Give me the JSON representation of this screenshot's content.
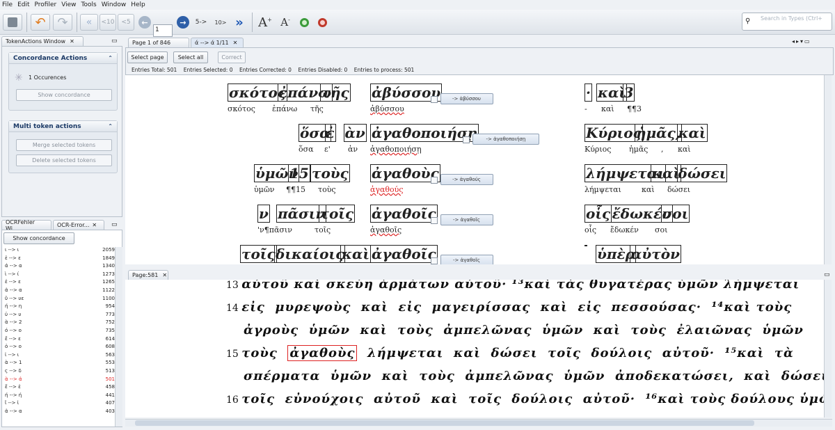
{
  "menu": [
    "File",
    "Edit",
    "Profiler",
    "View",
    "Tools",
    "Window",
    "Help"
  ],
  "toolbar": {
    "back_10": "<10",
    "back_5": "<5",
    "page_input": "1",
    "fwd_5": "5->",
    "fwd_10": "10>",
    "search_placeholder": "Search in Types (Ctrl+"
  },
  "token_actions": {
    "tab_label": "TokenActions Window",
    "concordance_title": "Concordance Actions",
    "occurrences": "1 Occurences",
    "show_concordance": "Show concordance",
    "multi_title": "Multi token actions",
    "merge": "Merge selected tokens",
    "delete": "Delete selected tokens"
  },
  "error_panel": {
    "tab1": "OCRFehler Wi...",
    "tab2": "OCR-Error...",
    "show_concordance": "Show concordance",
    "rows": [
      {
        "pattern": "ι --> ι",
        "count": "2059",
        "red": false
      },
      {
        "pattern": "ἑ --> ε",
        "count": "1849",
        "red": false
      },
      {
        "pattern": "ά --> α",
        "count": "1340",
        "red": false
      },
      {
        "pattern": "ὶ --> ί",
        "count": "1273",
        "red": false
      },
      {
        "pattern": "ἐ --> ε",
        "count": "1265",
        "red": false
      },
      {
        "pattern": "ἀ --> α",
        "count": "1122",
        "red": false
      },
      {
        "pattern": "ῦ --> υε",
        "count": "1100",
        "red": false
      },
      {
        "pattern": "ή --> η",
        "count": "954",
        "red": false
      },
      {
        "pattern": "ὐ --> υ",
        "count": "773",
        "red": false
      },
      {
        "pattern": "ὰ --> 2",
        "count": "752",
        "red": false
      },
      {
        "pattern": "ό --> ο",
        "count": "735",
        "red": false
      },
      {
        "pattern": "ἔ --> ε",
        "count": "614",
        "red": false
      },
      {
        "pattern": "ὁ --> ο",
        "count": "608",
        "red": false
      },
      {
        "pattern": "ἰ --> ι",
        "count": "563",
        "red": false
      },
      {
        "pattern": "ὰ --> 1",
        "count": "553",
        "red": false
      },
      {
        "pattern": "ς --> δ",
        "count": "513",
        "red": false
      },
      {
        "pattern": "ὰ --> ά",
        "count": "501",
        "red": true
      },
      {
        "pattern": "ἕ --> ἑ",
        "count": "458",
        "red": false
      },
      {
        "pattern": "ή --> ή",
        "count": "441",
        "red": false
      },
      {
        "pattern": "ῖ --> ἰ",
        "count": "407",
        "red": false
      },
      {
        "pattern": "ἀ --> α",
        "count": "403",
        "red": false
      }
    ]
  },
  "concordance": {
    "tab_page": "Page 1 of 846",
    "tab_conc": "ά --> ά 1/11",
    "select_page": "Select page",
    "select_all": "Select all",
    "correct": "Correct",
    "stats": "Entries Total: 501    Entries Selected: 0    Entries Corrected: 0    Entries Disabled: 0    Entries to process: 501",
    "rows": [
      {
        "left_img": [
          "σκότος",
          "ἐπάνω",
          "τῆς"
        ],
        "left_ocr": [
          "σκότος",
          "ἐπάνω",
          "τῆς"
        ],
        "mid_img": "ἀβύσσου",
        "mid_ocr": "ἀβύσσου",
        "btn": "-> ἀβύσσου",
        "right_img": [
          "·",
          "καὶ",
          "3"
        ],
        "right_ocr": [
          "-",
          "καὶ",
          "¶¶3"
        ]
      },
      {
        "left_img": [
          "ὅσα",
          "ἐ",
          "ὰν"
        ],
        "left_ocr": [
          "ὅσα",
          "ε'",
          "ἀν"
        ],
        "mid_img": "ἀγαθοποιήσῃ",
        "mid_ocr": "ἀγαθοποιήσῃ",
        "btn": "-> ἀγαθοποιήσῃ",
        "right_img": [
          "Κύριος",
          "ἡμᾶς,",
          "καὶ"
        ],
        "right_ocr": [
          "Κύριος",
          "ἡμᾶς",
          ",",
          "καὶ"
        ]
      },
      {
        "left_img": [
          "ὑμῶν",
          "15",
          "τοὺς"
        ],
        "left_ocr": [
          "ὑμῶν",
          "¶¶15",
          "τοὺς"
        ],
        "mid_img": "ἀγαθοὺς",
        "mid_ocr": "ἀγαθούς",
        "btn": "-> ἀγαθούς",
        "right_img": [
          "λήμψεται",
          "καὶ",
          "δώσει"
        ],
        "right_ocr": [
          "λήμψεται",
          "καὶ",
          "δώσει"
        ]
      },
      {
        "left_img": [
          "ν",
          "πᾶσιν",
          "τοῖς"
        ],
        "left_ocr": [
          "'ν¶πᾶσιν",
          "τοῖς"
        ],
        "mid_img": "ἀγαθοῖς",
        "mid_ocr": "ἀγαθοῖς",
        "btn": "-> ἀγαθοῖς",
        "right_img": [
          "οἷς",
          "ἔδωκέν",
          "σοι"
        ],
        "right_ocr": [
          "οἷς",
          "ἔδωκέν",
          "σοι"
        ]
      },
      {
        "left_img": [
          "τοῖς",
          "δικαίοις",
          "καὶ"
        ],
        "left_ocr": [],
        "mid_img": "ἀγαθοῖς",
        "mid_ocr": "",
        "btn": "-> ἀγαθοῖς",
        "right_img": [
          "",
          "ὑπὲρ",
          "αὐτὸν"
        ],
        "right_ocr": []
      }
    ]
  },
  "page_view": {
    "tab": "Page:581",
    "lines": [
      {
        "num": "13",
        "text": "αὐτοῦ καὶ σκεύη ἁρμάτων αὐτοῦ· ¹³καὶ τὰς θυγατέρας ὑμῶν λήμψεται"
      },
      {
        "num": "14",
        "text": "εἰς  μυρεψοὺς  καὶ  εἰς  μαγειρίσσας  καὶ  εἰς  πεσσούσας·  ¹⁴καὶ τοὺς"
      },
      {
        "num": "",
        "text": "ἀγροὺς  ὑμῶν  καὶ  τοὺς  ἀμπελῶνας  ὑμῶν  καὶ  τοὺς  ἐλαιῶνας  ὑμῶν"
      },
      {
        "num": "15",
        "text": "τοὺς  ἀγαθοὺς  λήμψεται  καὶ  δώσει  τοῖς  δούλοις  αὐτοῦ·  ¹⁵καὶ  τὰ"
      },
      {
        "num": "",
        "text": "σπέρματα  ὑμῶν  καὶ  τοὺς  ἀμπελῶνας  ὑμῶν  ἀποδεκατώσει,  καὶ  δώσει"
      },
      {
        "num": "16",
        "text": "τοῖς  εὐνούχοις  αὐτοῦ  καὶ  τοῖς  δούλοις  αὐτοῦ·  ¹⁶καὶ τοὺς δούλους ὑμῶν"
      }
    ]
  }
}
